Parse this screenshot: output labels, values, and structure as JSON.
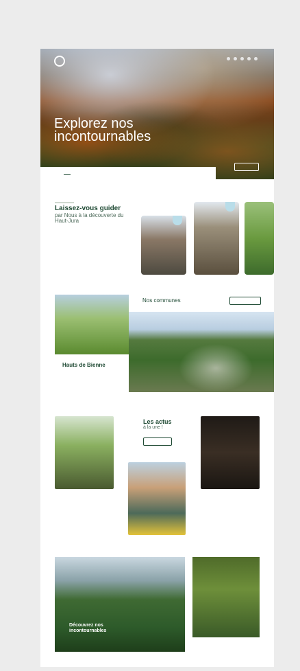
{
  "hero": {
    "title": "Explorez nos incontournables",
    "nav": [
      "",
      "",
      "",
      ""
    ],
    "side_text": "",
    "cta": ""
  },
  "tabs": [],
  "intro": {
    "title": "Laissez-vous guider",
    "subtitle": "par Nous à la découverte du Haut-Jura",
    "body": ""
  },
  "cards": [
    {
      "caption": ""
    },
    {
      "caption": ""
    },
    {
      "caption": ""
    }
  ],
  "communes": {
    "kicker": "",
    "title": "Nos communes",
    "button": "",
    "name": "Hauts de Bienne",
    "desc": "",
    "link": ""
  },
  "news": {
    "title": "Les actus",
    "subtitle": "à la une !",
    "button": "",
    "left_title": "",
    "left_link": "",
    "right_title": "",
    "right_link": ""
  },
  "bottom": {
    "kicker": "",
    "title": "Découvrez nos incontournables",
    "side_kicker": "",
    "side_title": ""
  },
  "colors": {
    "brand_green": "#1f4a34",
    "background": "#ececec"
  }
}
